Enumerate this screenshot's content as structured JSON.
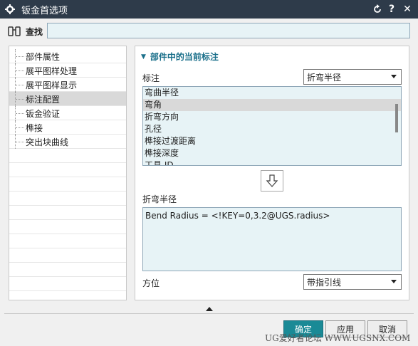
{
  "window": {
    "title": "钣金首选项"
  },
  "search": {
    "label": "查找",
    "value": ""
  },
  "tree": {
    "items": [
      {
        "label": "部件属性"
      },
      {
        "label": "展平图样处理"
      },
      {
        "label": "展平图样显示"
      },
      {
        "label": "标注配置",
        "selected": true
      },
      {
        "label": "钣金验证"
      },
      {
        "label": "榫接"
      },
      {
        "label": "突出块曲线"
      }
    ]
  },
  "panel": {
    "section_title": "部件中的当前标注",
    "annotation_label": "标注",
    "annotation_value": "折弯半径",
    "list": [
      {
        "label": "弯曲半径"
      },
      {
        "label": "弯角",
        "selected": true
      },
      {
        "label": "折弯方向"
      },
      {
        "label": "孔径"
      },
      {
        "label": "榫接过渡距离"
      },
      {
        "label": "榫接深度"
      },
      {
        "label": "工具 ID"
      }
    ],
    "text_label": "折弯半径",
    "text_value": "Bend Radius = <!KEY=0,3.2@UGS.radius>",
    "orientation_label": "方位",
    "orientation_value": "带指引线"
  },
  "buttons": {
    "ok": "确定",
    "apply": "应用",
    "cancel": "取消"
  },
  "watermark": "UG爱好者论坛 WWW.UGSNX.COM"
}
